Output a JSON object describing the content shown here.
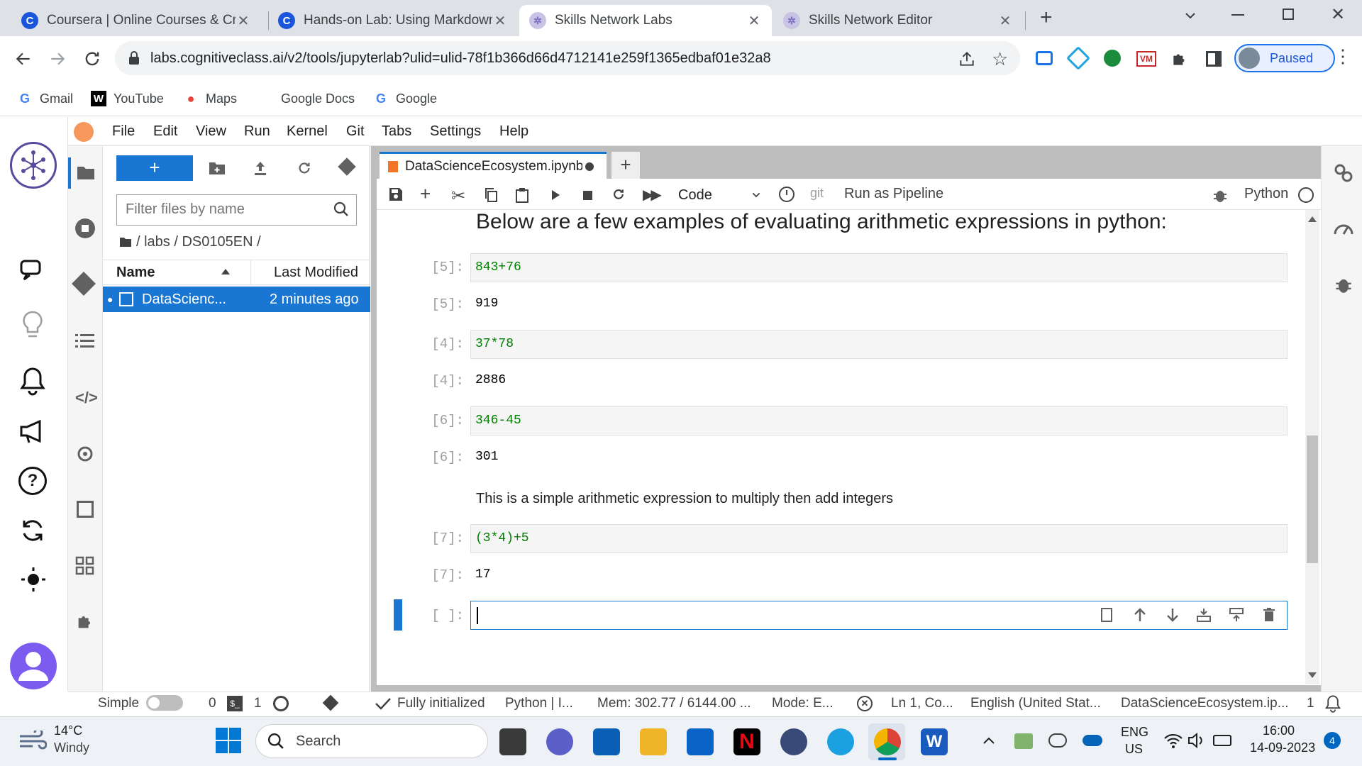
{
  "browser": {
    "tabs": [
      {
        "title": "Coursera | Online Courses & Cre"
      },
      {
        "title": "Hands-on Lab: Using Markdown"
      },
      {
        "title": "Skills Network Labs"
      },
      {
        "title": "Skills Network Editor"
      }
    ],
    "new_tab_symbol": "+",
    "url": "labs.cognitiveclass.ai/v2/tools/jupyterlab?ulid=ulid-78f1b366d66d4712141e259f1365edbaf01e32a8",
    "profile_label": "Paused",
    "bookmarks": [
      "Gmail",
      "YouTube",
      "Maps",
      "Google Docs",
      "Google"
    ]
  },
  "jupyter": {
    "menu": [
      "File",
      "Edit",
      "View",
      "Run",
      "Kernel",
      "Git",
      "Tabs",
      "Settings",
      "Help"
    ],
    "filebrowser": {
      "new_button": "+",
      "filter_placeholder": "Filter files by name",
      "breadcrumb": "/ labs / DS0105EN /",
      "col_name": "Name",
      "col_modified": "Last Modified",
      "files": [
        {
          "name": "DataScienc...",
          "modified": "2 minutes ago"
        }
      ]
    },
    "notebook": {
      "tab_title": "DataScienceEcosystem.ipynb",
      "new_tab_symbol": "+",
      "cell_type": "Code",
      "git_label": "git",
      "pipeline_label": "Run as Pipeline",
      "kernel": "Python",
      "heading": "Below are a few examples of evaluating arithmetic expressions in python:",
      "cells": [
        {
          "prompt": "[5]:",
          "code": "843+76",
          "out_prompt": "[5]:",
          "output": "919"
        },
        {
          "prompt": "[4]:",
          "code": "37*78",
          "out_prompt": "[4]:",
          "output": "2886"
        },
        {
          "prompt": "[6]:",
          "code": "346-45",
          "out_prompt": "[6]:",
          "output": "301"
        },
        {
          "prompt": "[7]:",
          "code": "(3*4)+5",
          "out_prompt": "[7]:",
          "output": "17"
        }
      ],
      "markdown_text": "This is a simple arithmetic expression to multiply then add integers",
      "empty_prompt": "[ ]:"
    },
    "status": {
      "mode_label": "Simple",
      "terminals": "0",
      "kernels": "1",
      "init": "Fully initialized",
      "kernel_status": "Python | I...",
      "mem": "Mem: 302.77 / 6144.00 ...",
      "mode": "Mode: E...",
      "position": "Ln 1, Co...",
      "language": "English (United Stat...",
      "file": "DataScienceEcosystem.ip...",
      "notif_count": "1"
    }
  },
  "taskbar": {
    "weather_temp": "14°C",
    "weather_desc": "Windy",
    "search_label": "Search",
    "lang": "ENG",
    "region": "US",
    "time": "16:00",
    "date": "14-09-2023",
    "notif_count": "4"
  }
}
